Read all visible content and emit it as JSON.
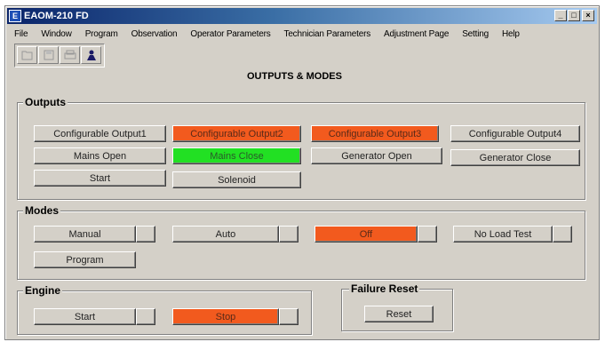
{
  "window": {
    "title": "EAOM-210 FD",
    "icon_text": "E"
  },
  "titlebar_buttons": {
    "minimize": "_",
    "maximize": "□",
    "close": "×"
  },
  "menu": [
    "File",
    "Window",
    "Program",
    "Observation",
    "Operator Parameters",
    "Technician Parameters",
    "Adjustment Page",
    "Setting",
    "Help"
  ],
  "toolbar": {
    "icons": [
      "open-icon",
      "save-icon",
      "print-icon",
      "user-icon"
    ]
  },
  "page_title": "OUTPUTS & MODES",
  "colors": {
    "active_red": "#f25a1e",
    "active_green": "#22e023"
  },
  "outputs": {
    "label": "Outputs",
    "buttons": [
      {
        "label": "Configurable Output1",
        "state": "normal"
      },
      {
        "label": "Configurable Output2",
        "state": "red"
      },
      {
        "label": "Configurable Output3",
        "state": "red"
      },
      {
        "label": "Configurable Output4",
        "state": "normal"
      },
      {
        "label": "Mains Open",
        "state": "normal"
      },
      {
        "label": "Mains Close",
        "state": "green"
      },
      {
        "label": "Generator Open",
        "state": "normal"
      },
      {
        "label": "Generator Close",
        "state": "normal"
      },
      {
        "label": "Start",
        "state": "normal"
      },
      {
        "label": "Solenoid",
        "state": "normal"
      }
    ]
  },
  "modes": {
    "label": "Modes",
    "buttons": [
      {
        "label": "Manual",
        "state": "normal"
      },
      {
        "label": "Auto",
        "state": "normal"
      },
      {
        "label": "Off",
        "state": "red"
      },
      {
        "label": "No Load Test",
        "state": "normal"
      },
      {
        "label": "Program",
        "state": "normal"
      }
    ]
  },
  "engine": {
    "label": "Engine",
    "buttons": [
      {
        "label": "Start",
        "state": "normal"
      },
      {
        "label": "Stop",
        "state": "red"
      }
    ]
  },
  "failure_reset": {
    "label": "Failure Reset",
    "button": "Reset"
  }
}
